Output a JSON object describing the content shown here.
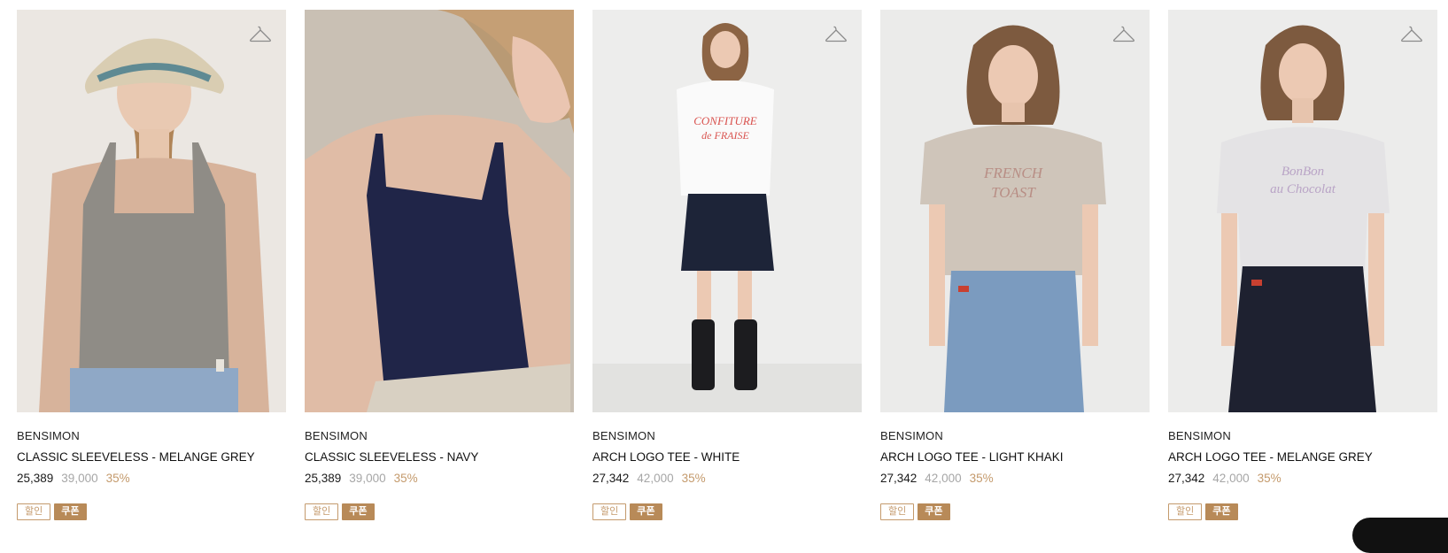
{
  "products": [
    {
      "brand": "BENSIMON",
      "name": "CLASSIC SLEEVELESS - MELANGE GREY",
      "sale_price": "25,389",
      "original_price": "39,000",
      "discount": "35%",
      "badges": [
        "할인",
        "쿠폰"
      ],
      "icon": "hanger-icon"
    },
    {
      "brand": "BENSIMON",
      "name": "CLASSIC SLEEVELESS - NAVY",
      "sale_price": "25,389",
      "original_price": "39,000",
      "discount": "35%",
      "badges": [
        "할인",
        "쿠폰"
      ],
      "icon": "hanger-icon"
    },
    {
      "brand": "BENSIMON",
      "name": "ARCH LOGO TEE - WHITE",
      "sale_price": "27,342",
      "original_price": "42,000",
      "discount": "35%",
      "badges": [
        "할인",
        "쿠폰"
      ],
      "icon": "hanger-icon"
    },
    {
      "brand": "BENSIMON",
      "name": "ARCH LOGO TEE - LIGHT KHAKI",
      "sale_price": "27,342",
      "original_price": "42,000",
      "discount": "35%",
      "badges": [
        "할인",
        "쿠폰"
      ],
      "icon": "hanger-icon"
    },
    {
      "brand": "BENSIMON",
      "name": "ARCH LOGO TEE - MELANGE GREY",
      "sale_price": "27,342",
      "original_price": "42,000",
      "discount": "35%",
      "badges": [
        "할인",
        "쿠폰"
      ],
      "icon": "hanger-icon"
    }
  ],
  "colors": {
    "accent": "#c49a6c",
    "badge_fill": "#b88a58",
    "original_price": "#a6a6a6"
  }
}
